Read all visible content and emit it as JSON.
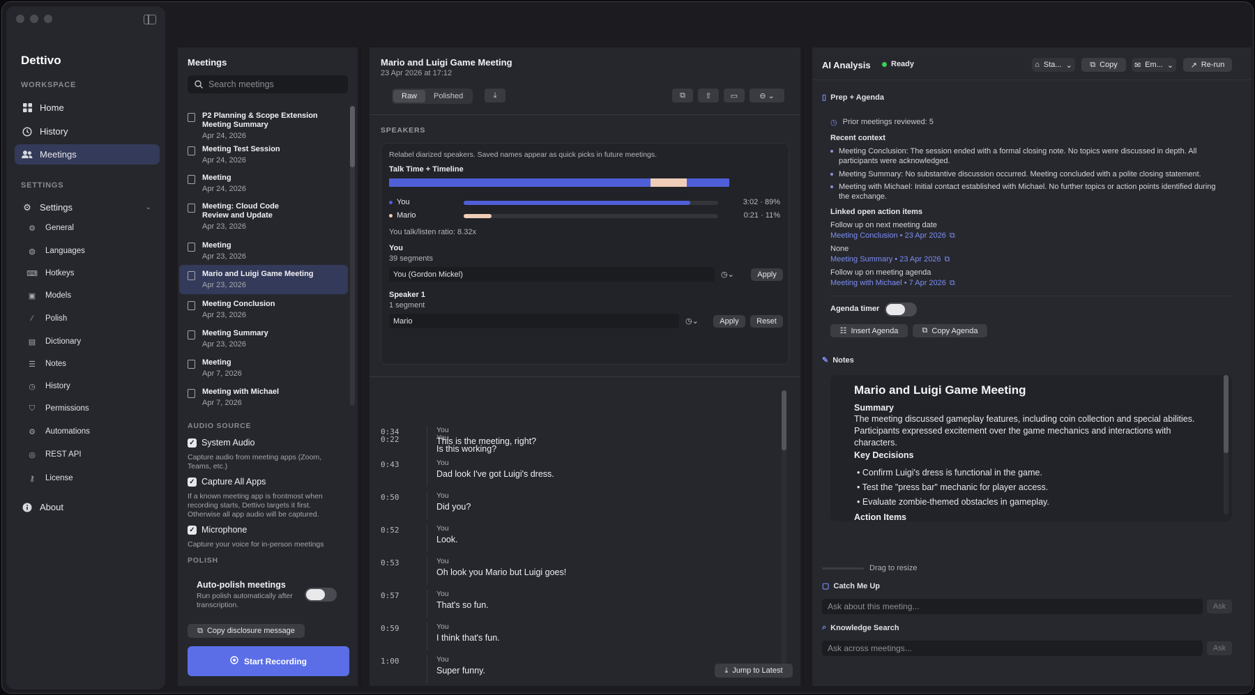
{
  "app": {
    "name": "Dettivo"
  },
  "sidebar": {
    "workspace_label": "WORKSPACE",
    "workspace_items": [
      {
        "label": "Home",
        "icon": "grid-icon"
      },
      {
        "label": "History",
        "icon": "clock-icon"
      },
      {
        "label": "Meetings",
        "icon": "people-icon"
      }
    ],
    "settings_label": "SETTINGS",
    "settings_header": "Settings",
    "settings_items": [
      {
        "label": "General",
        "icon": "gear-icon"
      },
      {
        "label": "Languages",
        "icon": "globe-icon"
      },
      {
        "label": "Hotkeys",
        "icon": "keyboard-icon"
      },
      {
        "label": "Models",
        "icon": "chip-icon"
      },
      {
        "label": "Polish",
        "icon": "wand-icon"
      },
      {
        "label": "Dictionary",
        "icon": "book-icon"
      },
      {
        "label": "Notes",
        "icon": "note-icon"
      },
      {
        "label": "History",
        "icon": "clock-icon"
      },
      {
        "label": "Permissions",
        "icon": "shield-icon"
      },
      {
        "label": "Automations",
        "icon": "automation-icon"
      },
      {
        "label": "REST API",
        "icon": "api-icon"
      },
      {
        "label": "License",
        "icon": "key-icon"
      }
    ],
    "about": "About"
  },
  "meetings": {
    "title": "Meetings",
    "search_placeholder": "Search meetings",
    "items": [
      {
        "title": "P2 Planning & Scope Extension Meeting Summary",
        "date": "Apr 24, 2026"
      },
      {
        "title": "Meeting Test Session",
        "date": "Apr 24, 2026"
      },
      {
        "title": "Meeting",
        "date": "Apr 24, 2026"
      },
      {
        "title": "Meeting: Cloud Code Review and Update",
        "date": "Apr 23, 2026"
      },
      {
        "title": "Meeting",
        "date": "Apr 23, 2026"
      },
      {
        "title": "Mario and Luigi Game Meeting",
        "date": "Apr 23, 2026"
      },
      {
        "title": "Meeting Conclusion",
        "date": "Apr 23, 2026"
      },
      {
        "title": "Meeting Summary",
        "date": "Apr 23, 2026"
      },
      {
        "title": "Meeting",
        "date": "Apr 7, 2026"
      },
      {
        "title": "Meeting with Michael",
        "date": "Apr 7, 2026"
      }
    ],
    "audio_source_label": "AUDIO SOURCE",
    "system_audio": "System Audio",
    "system_audio_help": "Capture audio from meeting apps (Zoom, Teams, etc.)",
    "capture_all": "Capture All Apps",
    "capture_all_help": "If a known meeting app is frontmost when recording starts, Dettivo targets it first. Otherwise all app audio will be captured.",
    "microphone": "Microphone",
    "microphone_help": "Capture your voice for in-person meetings",
    "polish_label": "POLISH",
    "auto_polish_title": "Auto-polish meetings",
    "auto_polish_help": "Run polish automatically after transcription.",
    "copy_disclosure": "Copy disclosure message",
    "start_recording": "Start Recording"
  },
  "center": {
    "title": "Mario and Luigi Game Meeting",
    "subtitle": "23 Apr 2026 at 17:12",
    "tab_raw": "Raw",
    "tab_polished": "Polished",
    "speakers_label": "SPEAKERS",
    "relabel_help": "Relabel diarized speakers. Saved names appear as quick picks in future meetings.",
    "talk_time_label": "Talk Time + Timeline",
    "speaker_stats": [
      {
        "name": "You",
        "stat": "3:02 · 89%",
        "share": 0.89,
        "color": "#4f5fd8"
      },
      {
        "name": "Mario",
        "stat": "0:21 · 11%",
        "share": 0.11,
        "color": "#f0cdb8"
      }
    ],
    "ratio": "You talk/listen ratio: 8.32x",
    "speaker_you": {
      "name": "You",
      "segments": "39 segments",
      "value": "You (Gordon Mickel)",
      "apply": "Apply"
    },
    "speaker_1": {
      "name": "Speaker 1",
      "segments": "1 segment",
      "value": "Mario",
      "apply": "Apply",
      "reset": "Reset"
    },
    "transcript": [
      {
        "time": "0:22",
        "speaker": "You",
        "text": "Is this working?"
      },
      {
        "time": "0:34",
        "speaker": "You",
        "text": "This is the meeting, right?"
      },
      {
        "time": "0:43",
        "speaker": "You",
        "text": "Dad look I've got Luigi's dress."
      },
      {
        "time": "0:50",
        "speaker": "You",
        "text": "Did you?"
      },
      {
        "time": "0:52",
        "speaker": "You",
        "text": "Look."
      },
      {
        "time": "0:53",
        "speaker": "You",
        "text": "Oh look you Mario but Luigi goes!"
      },
      {
        "time": "0:57",
        "speaker": "You",
        "text": "That's so fun."
      },
      {
        "time": "0:59",
        "speaker": "You",
        "text": "I think that's fun."
      },
      {
        "time": "1:00",
        "speaker": "You",
        "text": "Super funny."
      }
    ],
    "jump_latest": "Jump to Latest"
  },
  "ai": {
    "title": "AI Analysis",
    "status": "Ready",
    "style_btn": "Sta...",
    "copy_btn": "Copy",
    "email_btn": "Em...",
    "rerun_btn": "Re-run",
    "prep_label": "Prep + Agenda",
    "prior": "Prior meetings reviewed: 5",
    "recent_context_label": "Recent context",
    "recent_context": [
      "Meeting Conclusion: The session ended with a formal closing note. No topics were discussed in depth. All participants were acknowledged.",
      "Meeting Summary: No substantive discussion occurred. Meeting concluded with a polite closing statement.",
      "Meeting with Michael: Initial contact established with Michael. No further topics or action points identified during the exchange."
    ],
    "linked_label": "Linked open action items",
    "linked": [
      {
        "title": "Follow up on next meeting date",
        "link": "Meeting Conclusion • 23 Apr 2026"
      },
      {
        "title": "None",
        "link": "Meeting Summary • 23 Apr 2026"
      },
      {
        "title": "Follow up on meeting agenda",
        "link": "Meeting with Michael • 7 Apr 2026"
      }
    ],
    "agenda_timer": "Agenda timer",
    "insert_agenda": "Insert Agenda",
    "copy_agenda": "Copy Agenda",
    "notes_label": "Notes",
    "notes": {
      "title": "Mario and Luigi Game Meeting",
      "summary_h": "Summary",
      "summary": "The meeting discussed gameplay features, including coin collection and special abilities. Participants expressed excitement over the game mechanics and interactions with characters.",
      "decisions_h": "Key Decisions",
      "decisions": [
        "Confirm Luigi's dress is functional in the game.",
        "Test the \"press bar\" mechanic for player access.",
        "Evaluate zombie-themed obstacles in gameplay."
      ],
      "actions_h": "Action Items"
    },
    "drag_resize": "Drag to resize",
    "catch_up_label": "Catch Me Up",
    "catch_up_placeholder": "Ask about this meeting...",
    "knowledge_label": "Knowledge Search",
    "knowledge_placeholder": "Ask across meetings...",
    "ask": "Ask"
  },
  "colors": {
    "accent": "#5b6ee8",
    "status_green": "#3ccf5a",
    "link": "#7b8df2"
  }
}
